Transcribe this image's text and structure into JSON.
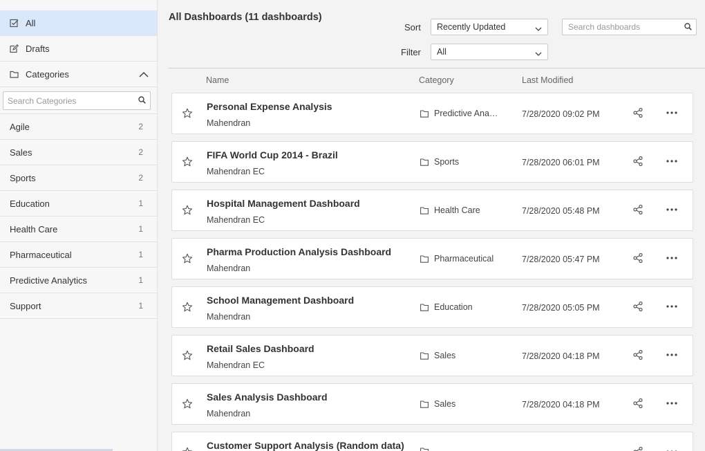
{
  "sidebar": {
    "nav": [
      {
        "label": "All",
        "icon": "checkbox-icon"
      },
      {
        "label": "Drafts",
        "icon": "edit-icon"
      }
    ],
    "categories_label": "Categories",
    "search_placeholder": "Search Categories",
    "categories": [
      {
        "name": "Agile",
        "count": "2"
      },
      {
        "name": "Sales",
        "count": "2"
      },
      {
        "name": "Sports",
        "count": "2"
      },
      {
        "name": "Education",
        "count": "1"
      },
      {
        "name": "Health Care",
        "count": "1"
      },
      {
        "name": "Pharmaceutical",
        "count": "1"
      },
      {
        "name": "Predictive Analytics",
        "count": "1"
      },
      {
        "name": "Support",
        "count": "1"
      }
    ]
  },
  "header": {
    "title": "All Dashboards (11 dashboards)",
    "sort_label": "Sort",
    "sort_value": "Recently Updated",
    "filter_label": "Filter",
    "filter_value": "All",
    "search_placeholder": "Search dashboards"
  },
  "columns": {
    "name": "Name",
    "category": "Category",
    "modified": "Last Modified"
  },
  "dashboards": [
    {
      "name": "Personal Expense Analysis",
      "author": "Mahendran",
      "category": "Predictive Analytics",
      "modified": "7/28/2020 09:02 PM"
    },
    {
      "name": "FIFA World Cup 2014 - Brazil",
      "author": "Mahendran EC",
      "category": "Sports",
      "modified": "7/28/2020 06:01 PM"
    },
    {
      "name": "Hospital Management Dashboard",
      "author": "Mahendran EC",
      "category": "Health Care",
      "modified": "7/28/2020 05:48 PM"
    },
    {
      "name": "Pharma Production Analysis Dashboard",
      "author": "Mahendran",
      "category": "Pharmaceutical",
      "modified": "7/28/2020 05:47 PM"
    },
    {
      "name": "School Management Dashboard",
      "author": "Mahendran",
      "category": "Education",
      "modified": "7/28/2020 05:05 PM"
    },
    {
      "name": "Retail Sales Dashboard",
      "author": "Mahendran EC",
      "category": "Sales",
      "modified": "7/28/2020 04:18 PM"
    },
    {
      "name": "Sales Analysis Dashboard",
      "author": "Mahendran",
      "category": "Sales",
      "modified": "7/28/2020 04:18 PM"
    },
    {
      "name": "Customer Support Analysis (Random data)",
      "author": "",
      "category": "",
      "modified": ""
    }
  ],
  "colors": {
    "active_bg": "#d9e8fb",
    "sidebar_bg": "#f7f7f7",
    "page_bg": "#f3f3f3"
  }
}
